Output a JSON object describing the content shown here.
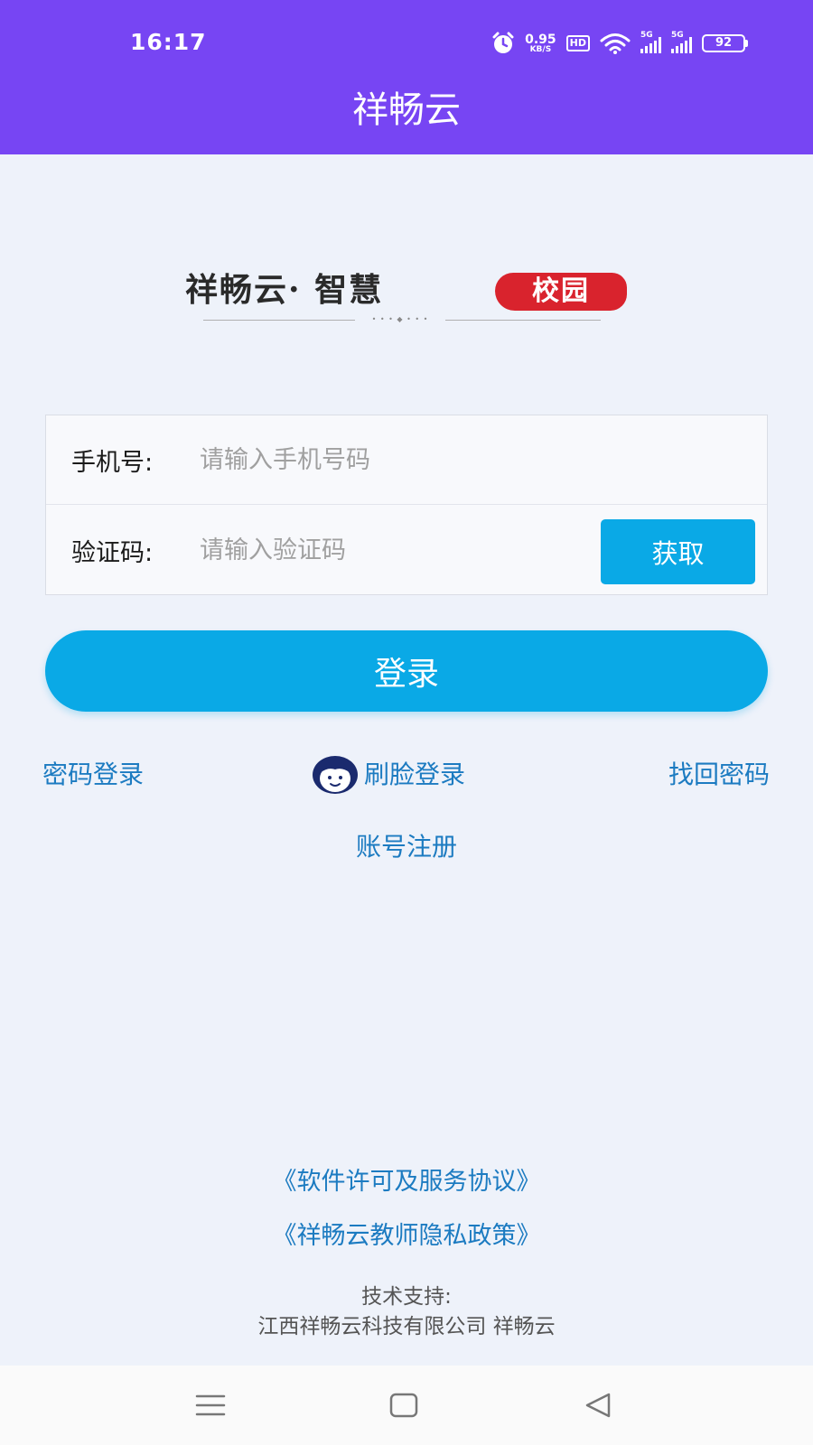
{
  "status_bar": {
    "time": "16:17",
    "net_speed": "0.95",
    "net_speed_unit": "KB/S",
    "hd_badge": "HD",
    "sim1_label": "5G",
    "sim2_label": "5G",
    "battery_level": "92",
    "icons": [
      "alarm-icon",
      "wifi-icon",
      "signal-icon",
      "battery-icon"
    ]
  },
  "header": {
    "title": "祥畅云"
  },
  "logo": {
    "text_left": "祥畅云· 智慧",
    "text_stamp": "校园",
    "ornament": "• • • ◆ • • •",
    "stamp_color": "#d9232d"
  },
  "form": {
    "phone_label": "手机号:",
    "phone_placeholder": "请输入手机号码",
    "code_label": "验证码:",
    "code_placeholder": "请输入验证码",
    "get_code_button": "获取"
  },
  "login_button": "登录",
  "links": {
    "password_login": "密码登录",
    "face_login": "刷脸登录",
    "find_password": "找回密码",
    "register": "账号注册"
  },
  "footer": {
    "license_agreement": "《软件许可及服务协议》",
    "privacy_policy": "《祥畅云教师隐私政策》",
    "support_label": "技术支持:",
    "support_company": "江西祥畅云科技有限公司 祥畅云"
  },
  "nav_bar": {
    "icons": [
      "menu-icon",
      "home-icon",
      "back-icon"
    ]
  },
  "colors": {
    "header": "#7745f3",
    "accent": "#0aa9e6",
    "link": "#1c7bc1",
    "background": "#eef2fa"
  }
}
